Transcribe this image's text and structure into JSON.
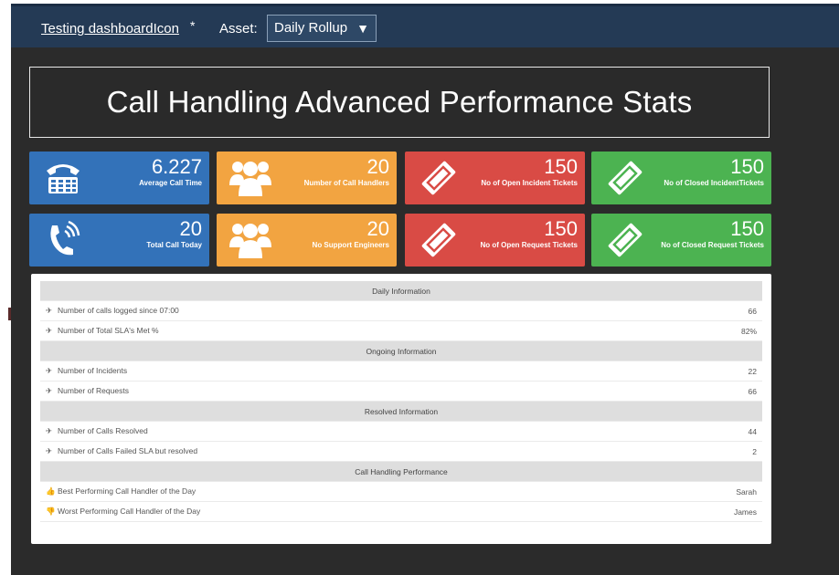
{
  "topbar": {
    "dashboard_title": "Testing dashboardIcon",
    "unsaved_marker": "*",
    "asset_label": "Asset:",
    "asset_selected": "Daily Rollup",
    "asset_caret": "▼"
  },
  "main_title": "Call Handling Advanced Performance Stats",
  "tiles": [
    {
      "value": "6.227",
      "label": "Average Call Time",
      "icon": "telephone-icon",
      "color": "#3372b9"
    },
    {
      "value": "20",
      "label": "Number of Call Handlers",
      "icon": "users-icon",
      "color": "#f2a441"
    },
    {
      "value": "150",
      "label": "No of Open Incident Tickets",
      "icon": "ticket-icon",
      "color": "#d94b45"
    },
    {
      "value": "150",
      "label": "No of Closed IncidentTickets",
      "icon": "ticket-icon",
      "color": "#4cb351"
    },
    {
      "value": "20",
      "label": "Total Call Today",
      "icon": "phone-ringing-icon",
      "color": "#3372b9"
    },
    {
      "value": "20",
      "label": "No Support Engineers",
      "icon": "users-icon",
      "color": "#f2a441"
    },
    {
      "value": "150",
      "label": "No of Open Request Tickets",
      "icon": "ticket-icon",
      "color": "#d94b45"
    },
    {
      "value": "150",
      "label": "No of Closed Request Tickets",
      "icon": "ticket-icon",
      "color": "#4cb351"
    }
  ],
  "sections": [
    {
      "heading": "Daily Information",
      "rows": [
        {
          "icon": "ticket-icon",
          "label": "Number of calls logged since 07:00",
          "value": "66"
        },
        {
          "icon": "ticket-icon",
          "label": "Number of Total SLA's Met %",
          "value": "82%"
        }
      ]
    },
    {
      "heading": "Ongoing Information",
      "rows": [
        {
          "icon": "ticket-icon",
          "label": "Number of Incidents",
          "value": "22"
        },
        {
          "icon": "ticket-icon",
          "label": "Number of Requests",
          "value": "66"
        }
      ]
    },
    {
      "heading": "Resolved Information",
      "rows": [
        {
          "icon": "ticket-icon",
          "label": "Number of Calls Resolved",
          "value": "44"
        },
        {
          "icon": "ticket-icon",
          "label": "Number of Calls Failed SLA but resolved",
          "value": "2"
        }
      ]
    },
    {
      "heading": "Call Handling Performance",
      "rows": [
        {
          "icon": "thumbs-up-icon",
          "label": "Best Performing Call Handler of the Day",
          "value": "Sarah"
        },
        {
          "icon": "thumbs-down-icon",
          "label": "Worst Performing Call Handler of the Day",
          "value": "James"
        }
      ]
    }
  ]
}
